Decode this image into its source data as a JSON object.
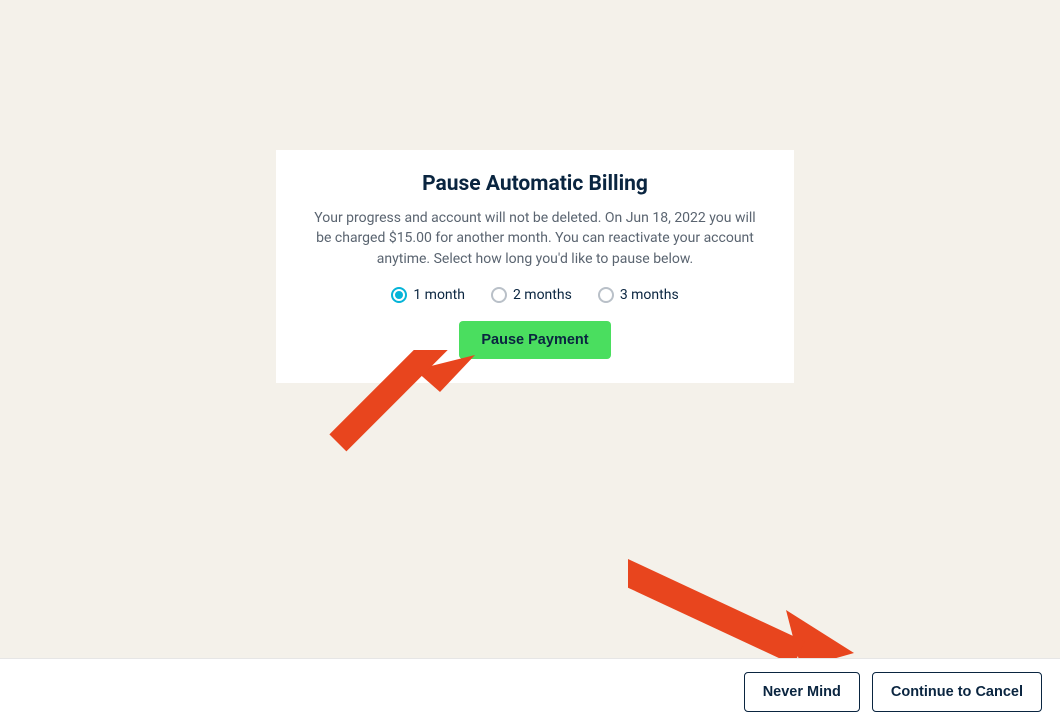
{
  "modal": {
    "title": "Pause Automatic Billing",
    "description": "Your progress and account will not be deleted. On Jun 18, 2022 you will be charged $15.00 for another month. You can reactivate your account anytime. Select how long you'd like to pause below.",
    "options": [
      {
        "label": "1 month",
        "selected": true
      },
      {
        "label": "2 months",
        "selected": false
      },
      {
        "label": "3 months",
        "selected": false
      }
    ],
    "pause_button_label": "Pause Payment"
  },
  "footer": {
    "never_mind_label": "Never Mind",
    "continue_cancel_label": "Continue to Cancel"
  },
  "colors": {
    "accent_radio": "#06b4d8",
    "button_green": "#4ade5f",
    "arrow": "#e8451e"
  }
}
